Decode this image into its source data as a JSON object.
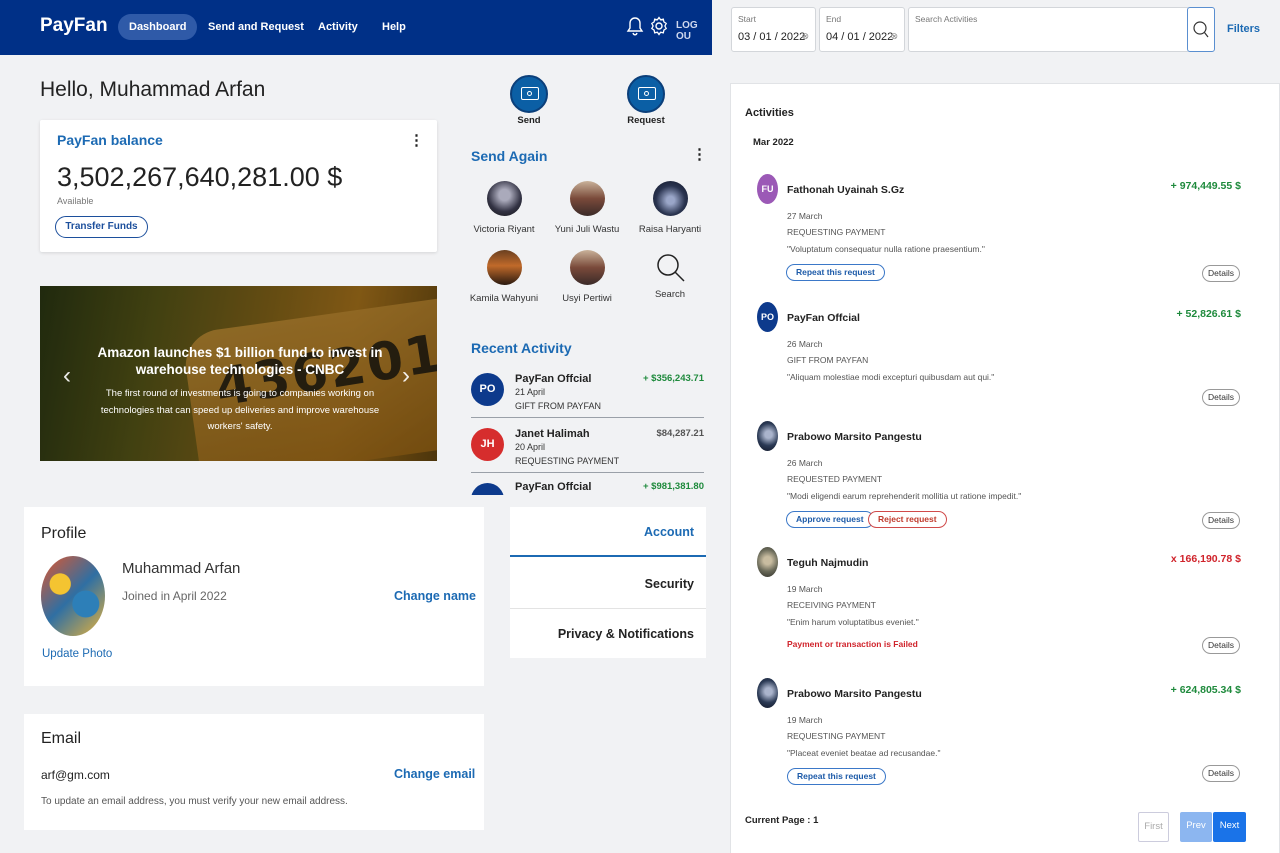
{
  "nav": {
    "brand": "PayFan",
    "links": [
      "Dashboard",
      "Send and Request",
      "Activity",
      "Help"
    ],
    "logout": "LOG OU"
  },
  "greeting": "Hello, Muhammad Arfan",
  "balance": {
    "title": "PayFan balance",
    "amount": "3,502,267,640,281.00 $",
    "sub": "Available",
    "transfer_label": "Transfer Funds"
  },
  "carousel": {
    "title": "Amazon launches $1 billion fund to invest in warehouse technologies - CNBC",
    "text": "The first round of investments is going to companies working on technologies that can speed up deliveries and improve warehouse workers' safety.",
    "digits": "436201"
  },
  "actions": {
    "send": "Send",
    "request": "Request"
  },
  "send_again": {
    "title": "Send Again",
    "contacts": [
      "Victoria Riyant",
      "Yuni Juli Wastu",
      "Raisa Haryanti",
      "Kamila Wahyuni",
      "Usyi Pertiwi",
      "Search"
    ]
  },
  "recent_activity": {
    "title": "Recent Activity",
    "items": [
      {
        "initials": "PO",
        "name": "PayFan Offcial",
        "date": "21 April",
        "type": "GIFT FROM PAYFAN",
        "amount": "+ $356,243.71",
        "amount_color": "#1e8a3c",
        "avatar_color": "#0d3a8c"
      },
      {
        "initials": "JH",
        "name": "Janet Halimah",
        "date": "20 April",
        "type": "REQUESTING PAYMENT",
        "amount": "$84,287.21",
        "amount_color": "#555555",
        "avatar_color": "#d62d2d"
      },
      {
        "initials": "",
        "name": "PayFan Offcial",
        "date": "",
        "type": "",
        "amount": "+ $981,381.80",
        "amount_color": "#1e8a3c",
        "avatar_color": "#0d3a8c"
      }
    ]
  },
  "profile": {
    "heading": "Profile",
    "name": "Muhammad Arfan",
    "joined": "Joined in April 2022",
    "change_name": "Change name",
    "update_photo": "Update Photo"
  },
  "email": {
    "heading": "Email",
    "value": "arf@gm.com",
    "change_email": "Change email",
    "note": "To update an email address, you must verify your new email address."
  },
  "settings_menu": [
    "Account",
    "Security",
    "Privacy & Notifications"
  ],
  "filters": {
    "start_label": "Start",
    "start_value": "03 / 01 / 2022",
    "end_label": "End",
    "end_value": "04 / 01 / 2022",
    "search_placeholder": "Search Activities",
    "filters_label": "Filters"
  },
  "activities": {
    "title": "Activities",
    "month": "Mar 2022",
    "items": [
      {
        "initials": "FU",
        "avatar_color": "#9b59b6",
        "name": "Fathonah Uyainah S.Gz",
        "date": "27 March",
        "type": "REQUESTING PAYMENT",
        "note": "\"Voluptatum consequatur nulla ratione praesentium.\"",
        "amount": "+ 974,449.55 $",
        "amount_color": "#1e8a3c",
        "buttons": [
          "Repeat this request"
        ],
        "details": "Details",
        "failed": ""
      },
      {
        "initials": "PO",
        "avatar_color": "#0d3a8c",
        "name": "PayFan Offcial",
        "date": "26 March",
        "type": "GIFT FROM PAYFAN",
        "note": "\"Aliquam molestiae modi excepturi quibusdam aut qui.\"",
        "amount": "+ 52,826.61 $",
        "amount_color": "#1e8a3c",
        "buttons": [],
        "details": "Details",
        "failed": ""
      },
      {
        "initials": "",
        "avatar_color": "#2b3a55",
        "name": "Prabowo Marsito Pangestu",
        "date": "26 March",
        "type": "REQUESTED PAYMENT",
        "note": "\"Modi eligendi earum reprehenderit mollitia ut ratione impedit.\"",
        "amount": "",
        "amount_color": "#1e8a3c",
        "buttons": [
          "Approve request",
          "Reject request"
        ],
        "details": "Details",
        "failed": ""
      },
      {
        "initials": "",
        "avatar_color": "#6b6b5a",
        "name": "Teguh Najmudin",
        "date": "19 March",
        "type": "RECEIVING PAYMENT",
        "note": "\"Enim harum voluptatibus eveniet.\"",
        "amount": "x 166,190.78 $",
        "amount_color": "#d0232b",
        "buttons": [],
        "details": "Details",
        "failed": "Payment or transaction is Failed"
      },
      {
        "initials": "",
        "avatar_color": "#2b3a55",
        "name": "Prabowo Marsito Pangestu",
        "date": "19 March",
        "type": "REQUESTING PAYMENT",
        "note": "\"Placeat eveniet beatae ad recusandae.\"",
        "amount": "+ 624,805.34 $",
        "amount_color": "#1e8a3c",
        "buttons": [
          "Repeat this request"
        ],
        "details": "Details",
        "failed": ""
      }
    ],
    "current_page": "Current Page : 1",
    "first": "First",
    "prev": "Prev",
    "next": "Next"
  }
}
